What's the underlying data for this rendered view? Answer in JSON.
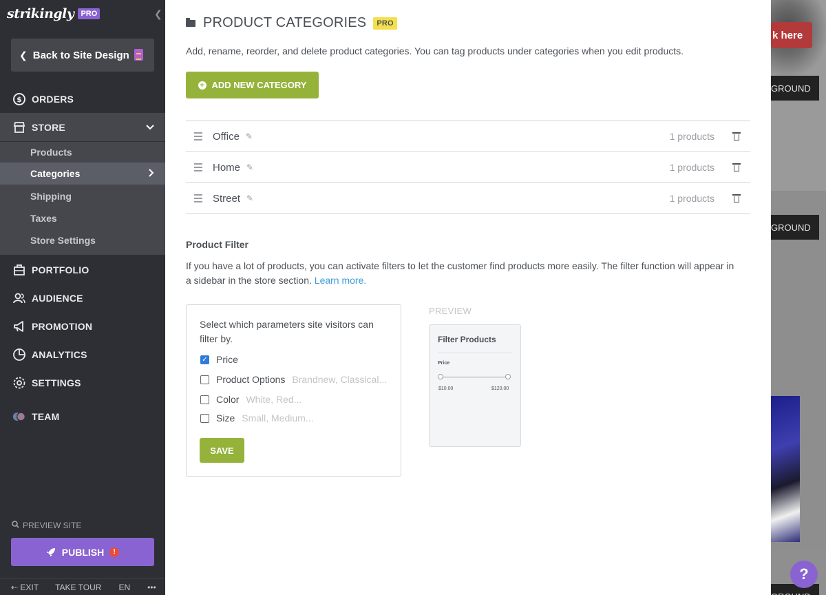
{
  "sidebar": {
    "logo": "strikingly",
    "plan_badge": "PRO",
    "back_label": "Back to Site Design",
    "nav": {
      "orders": "ORDERS",
      "store": "STORE",
      "portfolio": "PORTFOLIO",
      "audience": "AUDIENCE",
      "promotion": "PROMOTION",
      "analytics": "ANALYTICS",
      "settings": "SETTINGS",
      "team": "TEAM"
    },
    "store_sub": {
      "products": "Products",
      "categories": "Categories",
      "shipping": "Shipping",
      "taxes": "Taxes",
      "store_settings": "Store Settings"
    },
    "preview_site": "PREVIEW SITE",
    "publish": "PUBLISH",
    "publish_alert": "!",
    "footer": {
      "exit": "EXIT",
      "take_tour": "TAKE TOUR",
      "language": "EN",
      "more": "•••"
    }
  },
  "main": {
    "title": "PRODUCT CATEGORIES",
    "title_badge": "PRO",
    "intro": "Add, rename, reorder, and delete product categories. You can tag products under categories when you edit products.",
    "add_button": "ADD NEW CATEGORY",
    "categories": [
      {
        "name": "Office",
        "count": "1 products"
      },
      {
        "name": "Home",
        "count": "1 products"
      },
      {
        "name": "Street",
        "count": "1 products"
      }
    ],
    "filter": {
      "title": "Product Filter",
      "description": "If you have a lot of products, you can activate filters to let the customer find products more easily. The filter function will appear in a sidebar in the store section.",
      "learn_more": "Learn more.",
      "box_intro": "Select which parameters site visitors can filter by.",
      "options": [
        {
          "label": "Price",
          "hint": "",
          "checked": true
        },
        {
          "label": "Product Options",
          "hint": "Brandnew, Classical...",
          "checked": false
        },
        {
          "label": "Color",
          "hint": "White, Red...",
          "checked": false
        },
        {
          "label": "Size",
          "hint": "Small, Medium...",
          "checked": false
        }
      ],
      "save": "SAVE"
    },
    "preview": {
      "label": "PREVIEW",
      "card_title": "Filter Products",
      "price_label": "Price",
      "min": "$10.00",
      "max": "$120.00"
    }
  },
  "site_peek": {
    "red_button": "k here",
    "dark_button_1": "GROUND",
    "dark_button_2": "GROUND",
    "dark_button_3": "GROUND"
  },
  "help": "?",
  "colors": {
    "sidebar_bg": "#2e2f34",
    "accent_purple": "#8a63d2",
    "accent_green": "#95b33a",
    "link_blue": "#3a9bd9",
    "pro_yellow": "#f4e04d"
  }
}
